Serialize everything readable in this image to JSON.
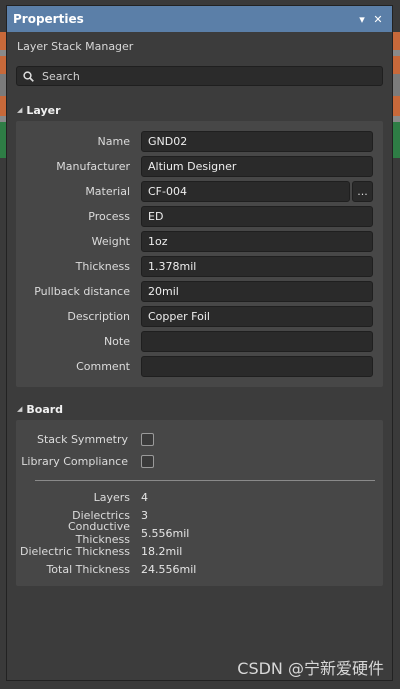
{
  "window": {
    "title": "Properties",
    "pin_icon": "dropdown-arrow-icon",
    "close_icon": "close-icon"
  },
  "subtitle": "Layer Stack Manager",
  "search": {
    "placeholder": "Search"
  },
  "colors": {
    "titlebar": "#5b7fa8",
    "panel": "#3c3c3c",
    "section": "#474747",
    "field": "#2a2a2a",
    "stripe_orange": "#c8693a",
    "stripe_green": "#2e7d45"
  },
  "layer": {
    "header": "Layer",
    "fields": [
      {
        "label": "Name",
        "value": "GND02"
      },
      {
        "label": "Manufacturer",
        "value": "Altium Designer"
      },
      {
        "label": "Material",
        "value": "CF-004",
        "button": "..."
      },
      {
        "label": "Process",
        "value": "ED"
      },
      {
        "label": "Weight",
        "value": "1oz"
      },
      {
        "label": "Thickness",
        "value": "1.378mil"
      },
      {
        "label": "Pullback distance",
        "value": "20mil"
      },
      {
        "label": "Description",
        "value": "Copper Foil"
      },
      {
        "label": "Note",
        "value": ""
      },
      {
        "label": "Comment",
        "value": ""
      }
    ]
  },
  "board": {
    "header": "Board",
    "checks": [
      {
        "label": "Stack Symmetry",
        "checked": false
      },
      {
        "label": "Library Compliance",
        "checked": false
      }
    ],
    "stats": [
      {
        "label": "Layers",
        "value": "4"
      },
      {
        "label": "Dielectrics",
        "value": "3"
      },
      {
        "label": "Conductive Thickness",
        "value": "5.556mil"
      },
      {
        "label": "Dielectric Thickness",
        "value": "18.2mil"
      },
      {
        "label": "Total Thickness",
        "value": "24.556mil"
      }
    ]
  },
  "watermark": "CSDN @宁新爱硬件"
}
